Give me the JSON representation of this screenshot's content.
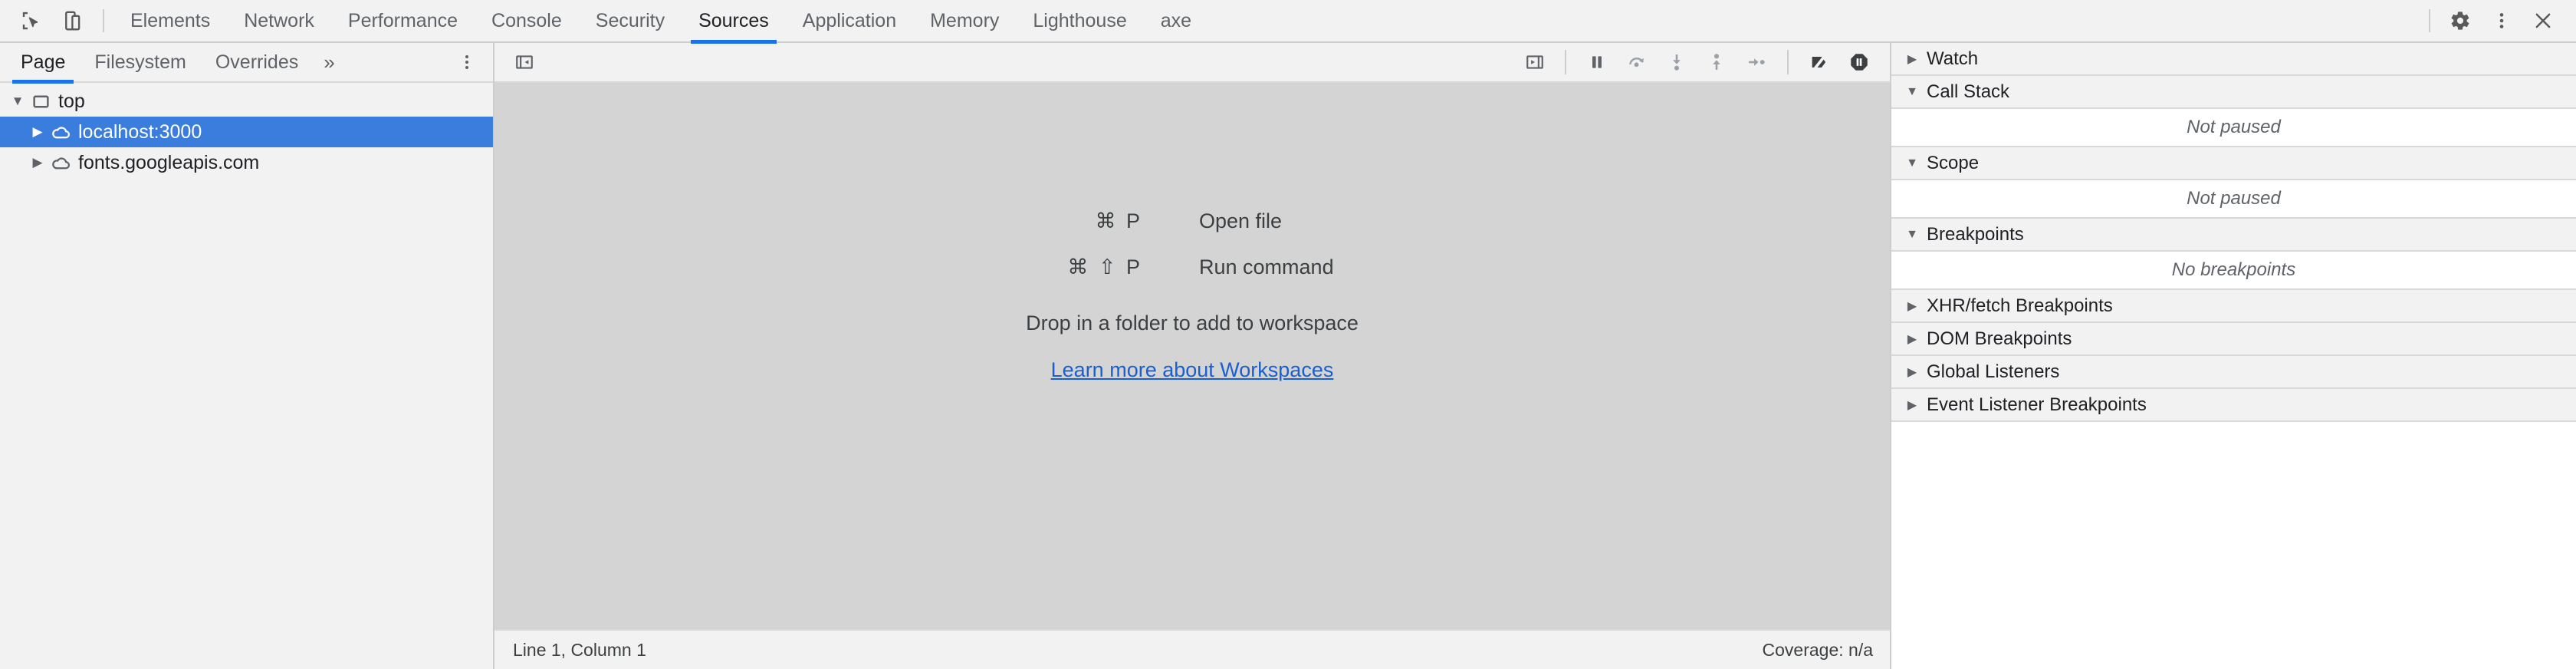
{
  "window": {
    "inspect_icon": "inspect-element-icon",
    "device_toolbar_icon": "device-toolbar-icon",
    "settings_icon": "gear-icon",
    "more_icon": "kebab-menu-icon",
    "close_icon": "close-icon"
  },
  "tabs": [
    {
      "label": "Elements",
      "active": false
    },
    {
      "label": "Network",
      "active": false
    },
    {
      "label": "Performance",
      "active": false
    },
    {
      "label": "Console",
      "active": false
    },
    {
      "label": "Security",
      "active": false
    },
    {
      "label": "Sources",
      "active": true
    },
    {
      "label": "Application",
      "active": false
    },
    {
      "label": "Memory",
      "active": false
    },
    {
      "label": "Lighthouse",
      "active": false
    },
    {
      "label": "axe",
      "active": false
    }
  ],
  "navigator": {
    "tabs": [
      {
        "label": "Page",
        "active": true
      },
      {
        "label": "Filesystem",
        "active": false
      },
      {
        "label": "Overrides",
        "active": false
      }
    ],
    "more_label": "»",
    "kebab_icon": "kebab-menu-icon",
    "tree": [
      {
        "label": "top",
        "icon": "frame-icon",
        "expanded": true,
        "selected": false,
        "depth": 0
      },
      {
        "label": "localhost:3000",
        "icon": "cloud-icon",
        "expanded": false,
        "selected": true,
        "depth": 1
      },
      {
        "label": "fonts.googleapis.com",
        "icon": "cloud-icon",
        "expanded": false,
        "selected": false,
        "depth": 1
      }
    ]
  },
  "editor": {
    "toolbar": {
      "show_navigator_icon": "show-navigator-panel-icon",
      "show_debugger_icon": "show-debugger-panel-icon",
      "debug_controls": [
        {
          "name": "pause-script-execution-icon",
          "title": "Pause script execution"
        },
        {
          "name": "step-over-icon",
          "title": "Step over next function call"
        },
        {
          "name": "step-into-icon",
          "title": "Step into next function call"
        },
        {
          "name": "step-out-icon",
          "title": "Step out of current function"
        },
        {
          "name": "step-icon",
          "title": "Step"
        },
        {
          "name": "deactivate-breakpoints-icon",
          "title": "Deactivate breakpoints"
        },
        {
          "name": "pause-on-exceptions-icon",
          "title": "Pause on exceptions"
        }
      ]
    },
    "splash": {
      "shortcuts": [
        {
          "keys": "⌘ P",
          "label": "Open file"
        },
        {
          "keys": "⌘ ⇧ P",
          "label": "Run command"
        }
      ],
      "drop_text": "Drop in a folder to add to workspace",
      "link_text": "Learn more about Workspaces"
    },
    "status": {
      "cursor": "Line 1, Column 1",
      "coverage": "Coverage: n/a"
    }
  },
  "debugger_sidebar": {
    "sections": [
      {
        "title": "Watch",
        "expanded": false,
        "body": null
      },
      {
        "title": "Call Stack",
        "expanded": true,
        "body": "Not paused"
      },
      {
        "title": "Scope",
        "expanded": true,
        "body": "Not paused"
      },
      {
        "title": "Breakpoints",
        "expanded": true,
        "body": "No breakpoints"
      },
      {
        "title": "XHR/fetch Breakpoints",
        "expanded": false,
        "body": null
      },
      {
        "title": "DOM Breakpoints",
        "expanded": false,
        "body": null
      },
      {
        "title": "Global Listeners",
        "expanded": false,
        "body": null
      },
      {
        "title": "Event Listener Breakpoints",
        "expanded": false,
        "body": null
      }
    ]
  },
  "colors": {
    "accent_blue": "#1a73e8",
    "selection_blue": "#3b7ddd",
    "link_blue": "#1a5fd0",
    "toolbar_bg": "#f2f2f2",
    "editor_bg": "#d4d4d4",
    "text": "#202124"
  }
}
